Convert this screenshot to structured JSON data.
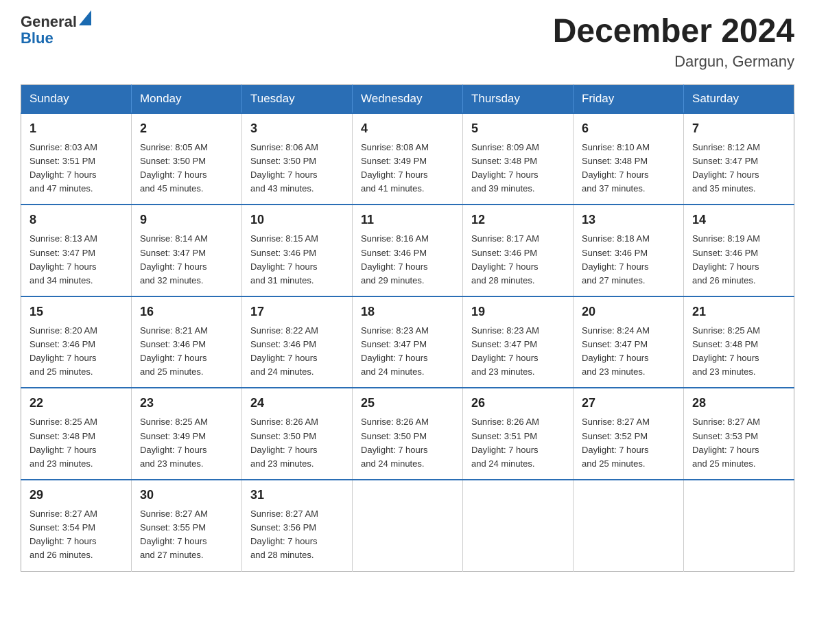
{
  "logo": {
    "general": "General",
    "blue": "Blue"
  },
  "header": {
    "title": "December 2024",
    "location": "Dargun, Germany"
  },
  "weekdays": [
    "Sunday",
    "Monday",
    "Tuesday",
    "Wednesday",
    "Thursday",
    "Friday",
    "Saturday"
  ],
  "weeks": [
    [
      {
        "day": "1",
        "info": "Sunrise: 8:03 AM\nSunset: 3:51 PM\nDaylight: 7 hours\nand 47 minutes."
      },
      {
        "day": "2",
        "info": "Sunrise: 8:05 AM\nSunset: 3:50 PM\nDaylight: 7 hours\nand 45 minutes."
      },
      {
        "day": "3",
        "info": "Sunrise: 8:06 AM\nSunset: 3:50 PM\nDaylight: 7 hours\nand 43 minutes."
      },
      {
        "day": "4",
        "info": "Sunrise: 8:08 AM\nSunset: 3:49 PM\nDaylight: 7 hours\nand 41 minutes."
      },
      {
        "day": "5",
        "info": "Sunrise: 8:09 AM\nSunset: 3:48 PM\nDaylight: 7 hours\nand 39 minutes."
      },
      {
        "day": "6",
        "info": "Sunrise: 8:10 AM\nSunset: 3:48 PM\nDaylight: 7 hours\nand 37 minutes."
      },
      {
        "day": "7",
        "info": "Sunrise: 8:12 AM\nSunset: 3:47 PM\nDaylight: 7 hours\nand 35 minutes."
      }
    ],
    [
      {
        "day": "8",
        "info": "Sunrise: 8:13 AM\nSunset: 3:47 PM\nDaylight: 7 hours\nand 34 minutes."
      },
      {
        "day": "9",
        "info": "Sunrise: 8:14 AM\nSunset: 3:47 PM\nDaylight: 7 hours\nand 32 minutes."
      },
      {
        "day": "10",
        "info": "Sunrise: 8:15 AM\nSunset: 3:46 PM\nDaylight: 7 hours\nand 31 minutes."
      },
      {
        "day": "11",
        "info": "Sunrise: 8:16 AM\nSunset: 3:46 PM\nDaylight: 7 hours\nand 29 minutes."
      },
      {
        "day": "12",
        "info": "Sunrise: 8:17 AM\nSunset: 3:46 PM\nDaylight: 7 hours\nand 28 minutes."
      },
      {
        "day": "13",
        "info": "Sunrise: 8:18 AM\nSunset: 3:46 PM\nDaylight: 7 hours\nand 27 minutes."
      },
      {
        "day": "14",
        "info": "Sunrise: 8:19 AM\nSunset: 3:46 PM\nDaylight: 7 hours\nand 26 minutes."
      }
    ],
    [
      {
        "day": "15",
        "info": "Sunrise: 8:20 AM\nSunset: 3:46 PM\nDaylight: 7 hours\nand 25 minutes."
      },
      {
        "day": "16",
        "info": "Sunrise: 8:21 AM\nSunset: 3:46 PM\nDaylight: 7 hours\nand 25 minutes."
      },
      {
        "day": "17",
        "info": "Sunrise: 8:22 AM\nSunset: 3:46 PM\nDaylight: 7 hours\nand 24 minutes."
      },
      {
        "day": "18",
        "info": "Sunrise: 8:23 AM\nSunset: 3:47 PM\nDaylight: 7 hours\nand 24 minutes."
      },
      {
        "day": "19",
        "info": "Sunrise: 8:23 AM\nSunset: 3:47 PM\nDaylight: 7 hours\nand 23 minutes."
      },
      {
        "day": "20",
        "info": "Sunrise: 8:24 AM\nSunset: 3:47 PM\nDaylight: 7 hours\nand 23 minutes."
      },
      {
        "day": "21",
        "info": "Sunrise: 8:25 AM\nSunset: 3:48 PM\nDaylight: 7 hours\nand 23 minutes."
      }
    ],
    [
      {
        "day": "22",
        "info": "Sunrise: 8:25 AM\nSunset: 3:48 PM\nDaylight: 7 hours\nand 23 minutes."
      },
      {
        "day": "23",
        "info": "Sunrise: 8:25 AM\nSunset: 3:49 PM\nDaylight: 7 hours\nand 23 minutes."
      },
      {
        "day": "24",
        "info": "Sunrise: 8:26 AM\nSunset: 3:50 PM\nDaylight: 7 hours\nand 23 minutes."
      },
      {
        "day": "25",
        "info": "Sunrise: 8:26 AM\nSunset: 3:50 PM\nDaylight: 7 hours\nand 24 minutes."
      },
      {
        "day": "26",
        "info": "Sunrise: 8:26 AM\nSunset: 3:51 PM\nDaylight: 7 hours\nand 24 minutes."
      },
      {
        "day": "27",
        "info": "Sunrise: 8:27 AM\nSunset: 3:52 PM\nDaylight: 7 hours\nand 25 minutes."
      },
      {
        "day": "28",
        "info": "Sunrise: 8:27 AM\nSunset: 3:53 PM\nDaylight: 7 hours\nand 25 minutes."
      }
    ],
    [
      {
        "day": "29",
        "info": "Sunrise: 8:27 AM\nSunset: 3:54 PM\nDaylight: 7 hours\nand 26 minutes."
      },
      {
        "day": "30",
        "info": "Sunrise: 8:27 AM\nSunset: 3:55 PM\nDaylight: 7 hours\nand 27 minutes."
      },
      {
        "day": "31",
        "info": "Sunrise: 8:27 AM\nSunset: 3:56 PM\nDaylight: 7 hours\nand 28 minutes."
      },
      null,
      null,
      null,
      null
    ]
  ]
}
